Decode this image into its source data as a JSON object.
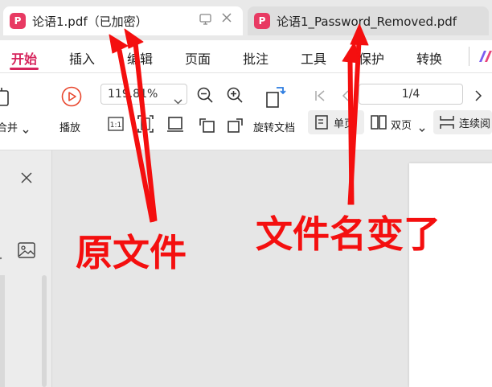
{
  "tabs": [
    {
      "title": "论语1.pdf（已加密）",
      "active": true
    },
    {
      "title": "论语1_Password_Removed.pdf",
      "active": false
    }
  ],
  "menu": [
    "开始",
    "插入",
    "编辑",
    "页面",
    "批注",
    "工具",
    "保护",
    "转换"
  ],
  "active_menu": "开始",
  "toolbar": {
    "merge_label": "合并",
    "play_label": "播放",
    "zoom_value": "119.81%",
    "rotate_label": "旋转文档",
    "page_indicator": "1/4",
    "single_page": "单页",
    "double_page": "双页",
    "continuous": "连续阅"
  },
  "annotations": {
    "original_file": "原文件",
    "filename_changed": "文件名变了"
  },
  "colors": {
    "accent": "#d6245c",
    "pdf_logo": "#e83a63",
    "annotation": "#f40f0f"
  },
  "icons": [
    "pdf-logo-icon",
    "monitor-icon",
    "close-icon",
    "play-icon",
    "zoom-out-icon",
    "zoom-in-icon",
    "rotate-icon",
    "chevron-down-icon",
    "first-page-icon",
    "prev-page-icon",
    "next-page-icon",
    "image-icon"
  ]
}
